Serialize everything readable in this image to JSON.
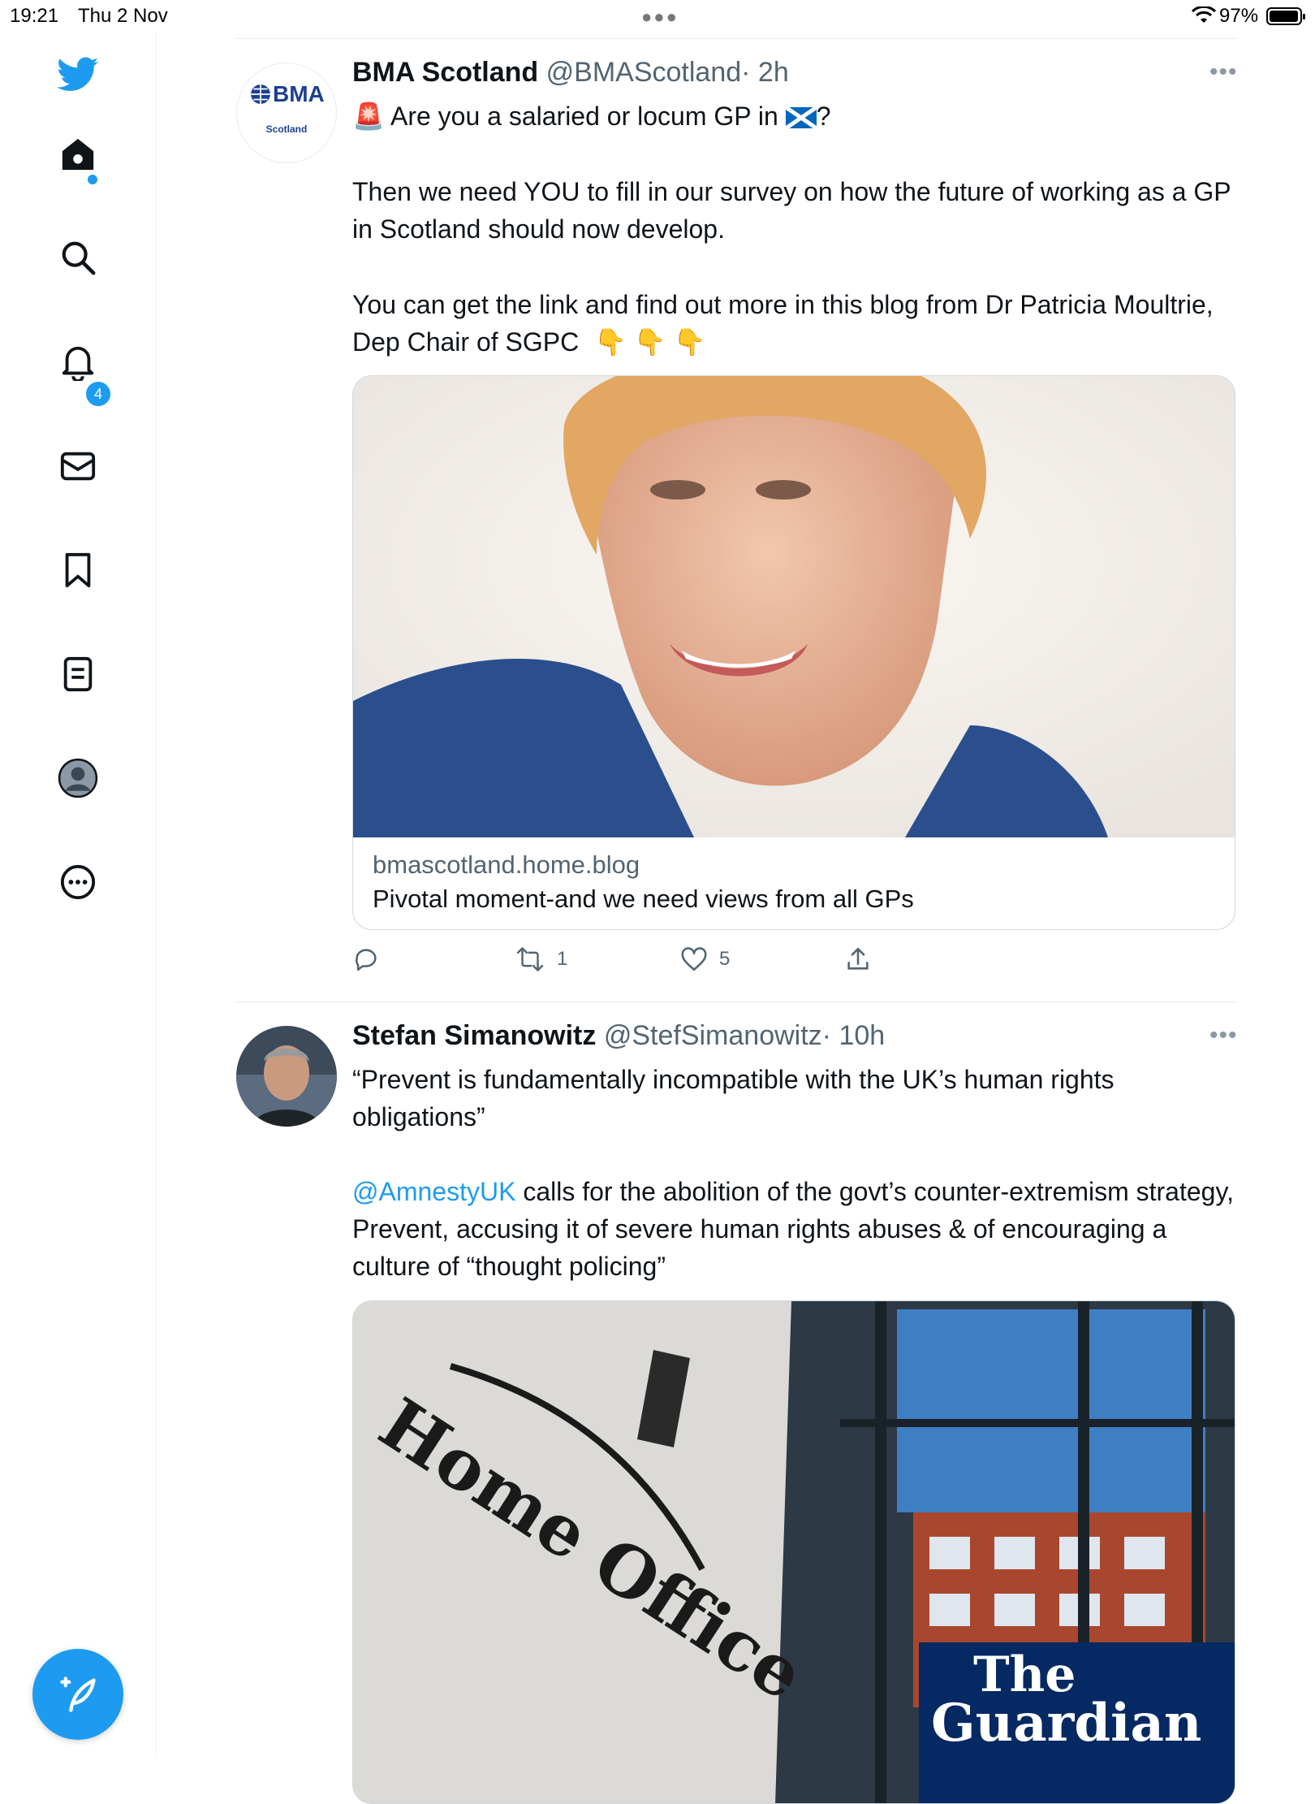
{
  "status_bar": {
    "time": "19:21",
    "date": "Thu 2 Nov",
    "battery": "97%"
  },
  "sidebar": {
    "notifications_badge": "4",
    "items": [
      "twitter-logo",
      "home",
      "explore",
      "notifications",
      "messages",
      "bookmarks",
      "lists",
      "profile",
      "more"
    ]
  },
  "tweets": [
    {
      "name": "BMA Scotland",
      "handle": "@BMAScotland",
      "time": "· 2h",
      "avatar_text": {
        "brand": "BMA",
        "sub": "Scotland"
      },
      "line1": "Are you a salaried or locum GP in",
      "line1_end": "?",
      "para2": "Then we need YOU to fill in our survey on how the future of working as a GP in Scotland should now develop.",
      "para3": "You can get the link and find out more in this blog from Dr Patricia Moultrie, Dep Chair of SGPC",
      "emoji_siren": "🚨",
      "emoji_flag": "🏴",
      "emoji_point": "👇 👇 👇",
      "card": {
        "domain": "bmascotland.home.blog",
        "title": "Pivotal moment-and we need views from all GPs"
      },
      "actions": {
        "retweets": "1",
        "likes": "5"
      }
    },
    {
      "name": "Stefan Simanowitz",
      "handle": "@StefSimanowitz",
      "time": "· 10h",
      "quote": "“Prevent is fundamentally incompatible with the UK’s human rights obligations”",
      "mention": "@AmnestyUK",
      "para2_rest": " calls for the abolition of the govt’s counter-extremism strategy, Prevent, accusing it of severe human rights abuses & of encouraging a culture of “thought policing”",
      "image_sign": "Home Office",
      "image_logo_line1": "The",
      "image_logo_line2": "Guardian"
    }
  ],
  "colors": {
    "accent": "#1d9bf0",
    "text": "#0f1419",
    "secondary": "#536471",
    "guardian_blue": "#052962"
  }
}
